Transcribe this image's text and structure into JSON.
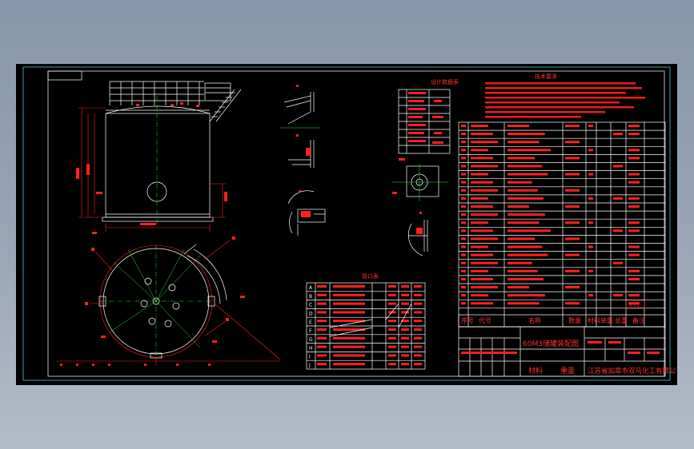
{
  "colors": {
    "background": "#9aa6b7",
    "canvas": "#000000",
    "frame": "#2fd9d9",
    "lines": "#ffffff",
    "annotation": "#ff2020",
    "centerline": "#38e038"
  },
  "drawing": {
    "nozzle_table_title": "管口表",
    "tech_requirements_title": "技术要求",
    "design_data_title": "设计数据表",
    "drawing_title": "60M3储罐装配图",
    "company_name": "江苏省如皋市双马化工有限公司",
    "col_material": "材料",
    "col_weight": "重量",
    "bom_header": [
      "序号",
      "代号",
      "名称",
      "数量",
      "材料",
      "单重",
      "总重",
      "备注"
    ],
    "bom_part_number": "V-01",
    "nozzle_letters": [
      "A",
      "B",
      "C",
      "D",
      "E",
      "F",
      "G",
      "H",
      "I",
      "J"
    ]
  }
}
